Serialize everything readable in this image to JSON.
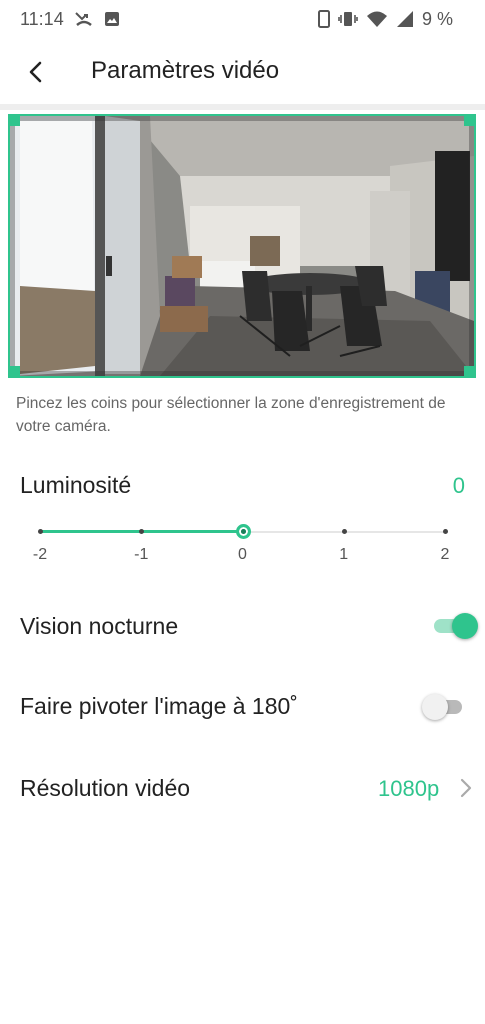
{
  "status_bar": {
    "time": "11:14",
    "battery": "9 %",
    "icons": [
      "missed-call-icon",
      "image-icon",
      "phone-icon",
      "vibrate-icon",
      "wifi-icon",
      "signal-icon"
    ]
  },
  "header": {
    "title": "Paramètres vidéo",
    "back_icon": "chevron-left-icon"
  },
  "preview": {
    "hint": "Pincez les coins pour sélectionner la zone d'enregistrement de votre caméra."
  },
  "brightness": {
    "label": "Luminosité",
    "value": "0",
    "ticks": [
      "-2",
      "-1",
      "0",
      "1",
      "2"
    ],
    "selected_index": 2
  },
  "night_vision": {
    "label": "Vision nocturne",
    "enabled": true
  },
  "rotate": {
    "label": "Faire pivoter l'image à 180˚",
    "enabled": false
  },
  "resolution": {
    "label": "Résolution vidéo",
    "value": "1080p"
  },
  "colors": {
    "accent": "#2fc48d",
    "text": "#222222",
    "muted": "#666666"
  }
}
